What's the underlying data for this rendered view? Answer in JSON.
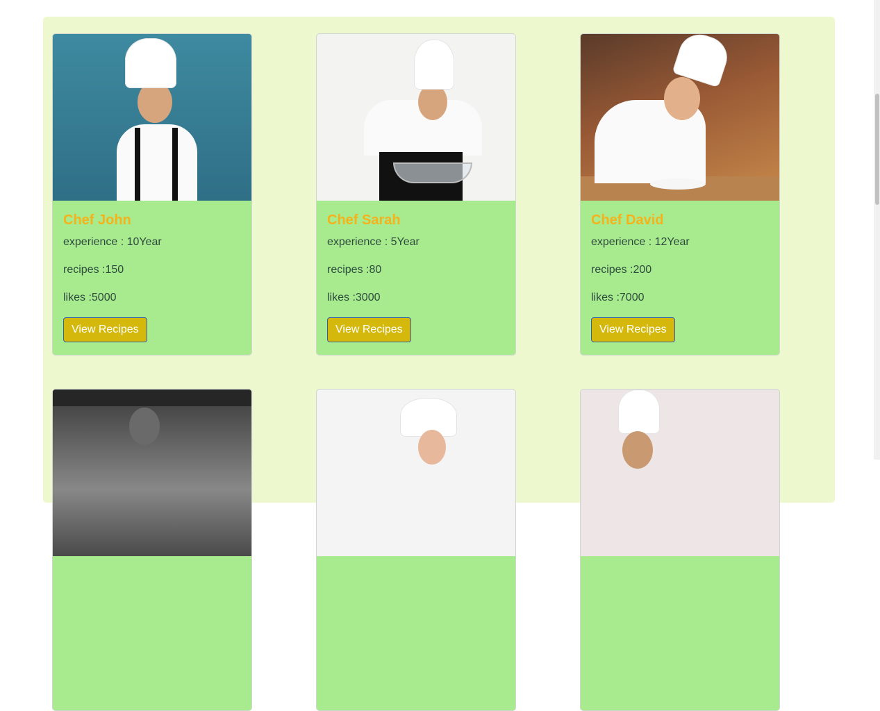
{
  "chefs": [
    {
      "name": "Chef John",
      "experience": "experience : 10Year",
      "recipes": "recipes :150",
      "likes": "likes :5000",
      "button": "View Recipes",
      "photo": "chef-portrait-blue-background"
    },
    {
      "name": "Chef Sarah",
      "experience": "experience : 5Year",
      "recipes": "recipes :80",
      "likes": "likes :3000",
      "button": "View Recipes",
      "photo": "chef-whisking-bowl"
    },
    {
      "name": "Chef David",
      "experience": "experience : 12Year",
      "recipes": "recipes :200",
      "likes": "likes :7000",
      "button": "View Recipes",
      "photo": "chef-plating-in-kitchen"
    }
  ],
  "partial_cards": [
    {
      "photo": "chef-black-and-white-kitchen"
    },
    {
      "photo": "chef-hat-white-background"
    },
    {
      "photo": "chef-hat-pink-background"
    }
  ],
  "colors": {
    "panel": "#eef8cf",
    "card": "#a8eb8f",
    "name": "#f5b21b",
    "button": "#d4b80b",
    "button_border": "#2f5fa8"
  }
}
